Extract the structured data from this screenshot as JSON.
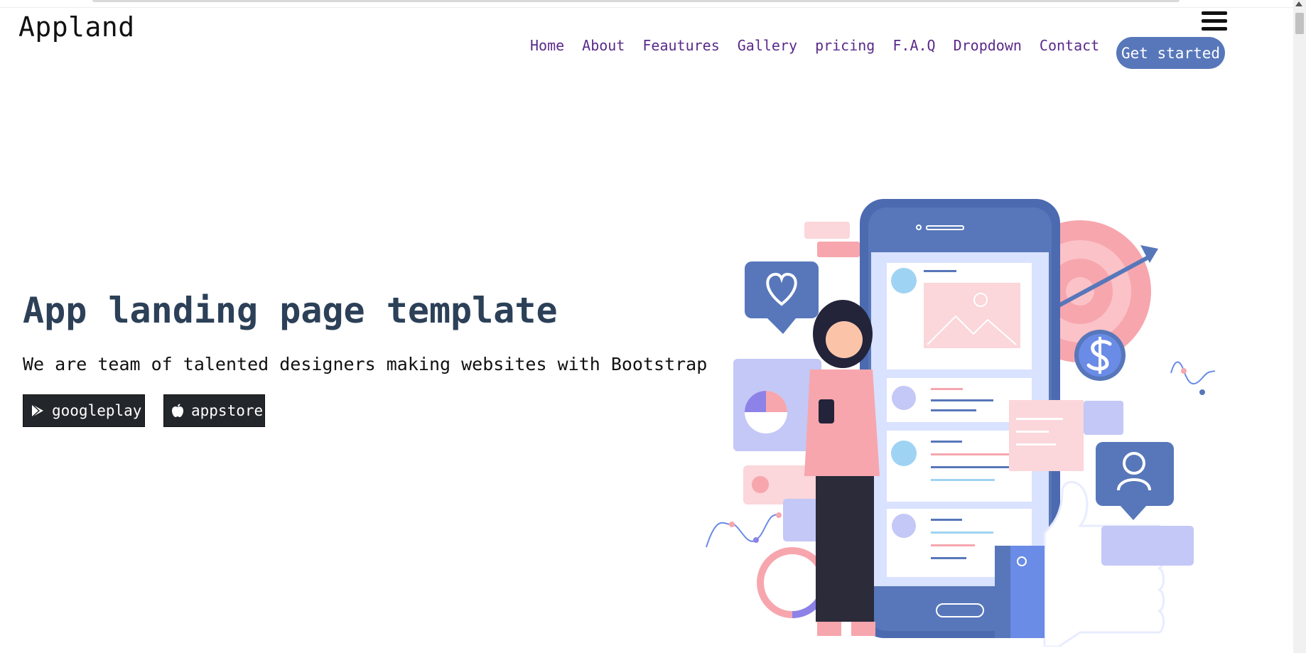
{
  "brand": "Appland",
  "nav": {
    "items": [
      "Home",
      "About",
      "Feautures",
      "Gallery",
      "pricing",
      "F.A.Q",
      "Dropdown",
      "Contact"
    ],
    "cta": "Get started"
  },
  "hero": {
    "title": "App landing page template",
    "subtitle": "We are team of talented designers making websites with Bootstrap",
    "buttons": {
      "googleplay": "googleplay",
      "appstore": "appstore"
    }
  },
  "colors": {
    "accent": "#5777ba",
    "nav_link": "#5a2a8a",
    "title": "#2c4058",
    "store_button": "#23272b"
  },
  "icons": [
    "menu-icon",
    "play-store-icon",
    "apple-icon"
  ]
}
